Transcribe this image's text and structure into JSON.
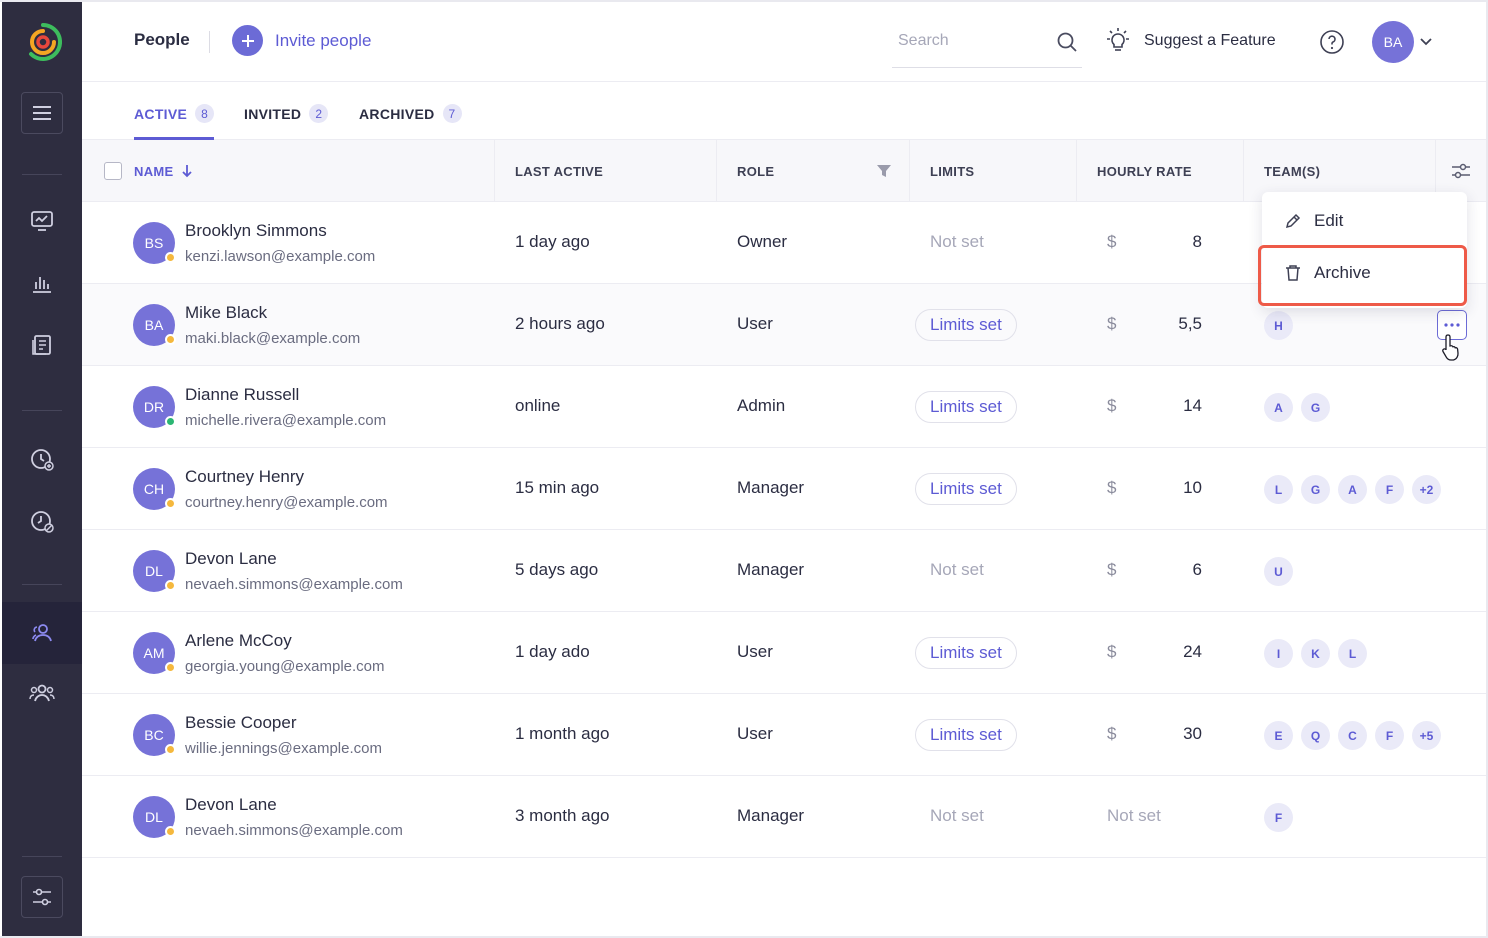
{
  "header": {
    "title": "People",
    "invite_label": "Invite people",
    "search_placeholder": "Search",
    "suggest_label": "Suggest a Feature",
    "user_initials": "BA"
  },
  "tabs": [
    {
      "label": "ACTIVE",
      "count": "8",
      "active": true
    },
    {
      "label": "INVITED",
      "count": "2",
      "active": false
    },
    {
      "label": "ARCHIVED",
      "count": "7",
      "active": false
    }
  ],
  "columns": {
    "name": "NAME",
    "last_active": "LAST ACTIVE",
    "role": "ROLE",
    "limits": "LIMITS",
    "hourly_rate": "HOURLY RATE",
    "teams": "TEAM(S)"
  },
  "rows": [
    {
      "initials": "BS",
      "name": "Brooklyn Simmons",
      "email": "kenzi.lawson@example.com",
      "status": "away",
      "last_active": "1 day ago",
      "role": "Owner",
      "limits": "Not set",
      "currency": "$",
      "rate": "8",
      "teams": []
    },
    {
      "initials": "BA",
      "name": "Mike Black",
      "email": "maki.black@example.com",
      "status": "away",
      "last_active": "2 hours ago",
      "role": "User",
      "limits": "Limits set",
      "currency": "$",
      "rate": "5,5",
      "teams": [
        "H"
      ]
    },
    {
      "initials": "DR",
      "name": "Dianne Russell",
      "email": "michelle.rivera@example.com",
      "status": "online",
      "last_active": "online",
      "role": "Admin",
      "limits": "Limits set",
      "currency": "$",
      "rate": "14",
      "teams": [
        "A",
        "G"
      ]
    },
    {
      "initials": "CH",
      "name": "Courtney Henry",
      "email": "courtney.henry@example.com",
      "status": "away",
      "last_active": "15 min ago",
      "role": "Manager",
      "limits": "Limits set",
      "currency": "$",
      "rate": "10",
      "teams": [
        "L",
        "G",
        "A",
        "F",
        "+2"
      ]
    },
    {
      "initials": "DL",
      "name": "Devon Lane",
      "email": "nevaeh.simmons@example.com",
      "status": "away",
      "last_active": "5 days ago",
      "role": "Manager",
      "limits": "Not set",
      "currency": "$",
      "rate": "6",
      "teams": [
        "U"
      ]
    },
    {
      "initials": "AM",
      "name": "Arlene McCoy",
      "email": "georgia.young@example.com",
      "status": "away",
      "last_active": "1 day ado",
      "role": "User",
      "limits": "Limits set",
      "currency": "$",
      "rate": "24",
      "teams": [
        "I",
        "K",
        "L"
      ]
    },
    {
      "initials": "BC",
      "name": "Bessie Cooper",
      "email": "willie.jennings@example.com",
      "status": "away",
      "last_active": "1 month ago",
      "role": "User",
      "limits": "Limits set",
      "currency": "$",
      "rate": "30",
      "teams": [
        "E",
        "Q",
        "C",
        "F",
        "+5"
      ]
    },
    {
      "initials": "DL",
      "name": "Devon Lane",
      "email": "nevaeh.simmons@example.com",
      "status": "away",
      "last_active": "3 month ago",
      "role": "Manager",
      "limits": "Not set",
      "currency": "",
      "rate": "Not set",
      "teams": [
        "F"
      ]
    }
  ],
  "row_menu": {
    "edit_label": "Edit",
    "archive_label": "Archive"
  },
  "colors": {
    "accent": "#5d5bd4",
    "avatar": "#7672d8",
    "sidebar": "#2e2d40",
    "highlight": "#ee5a48",
    "status_away": "#f5b83d",
    "status_online": "#2bb673"
  },
  "icons": {
    "sidebar": [
      "app-logo-icon",
      "menu-icon",
      "dashboard-icon",
      "reports-icon",
      "timesheet-icon",
      "add-time-icon",
      "time-off-icon",
      "people-icon",
      "teams-icon",
      "settings-icon"
    ],
    "header": [
      "plus-icon",
      "search-icon",
      "lightbulb-icon",
      "help-icon",
      "chevron-down-icon"
    ],
    "table": [
      "sort-down-icon",
      "filter-icon",
      "column-settings-icon",
      "more-icon",
      "pencil-icon",
      "trash-icon",
      "pointer-cursor-icon"
    ]
  }
}
